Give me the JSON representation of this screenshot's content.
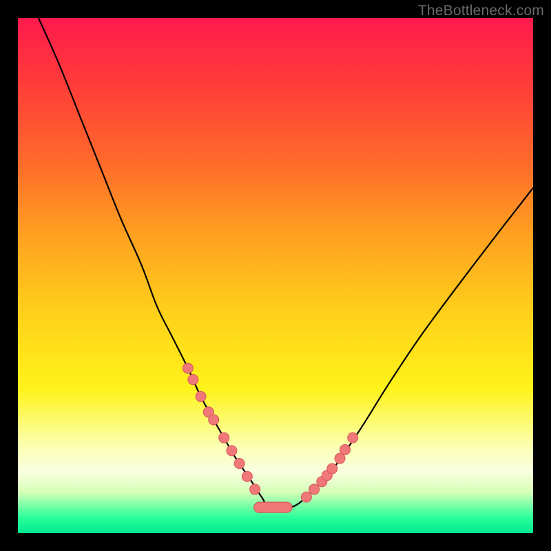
{
  "watermark": "TheBottleneck.com",
  "colors": {
    "gradient_top": "#ff1a4d",
    "gradient_bottom": "#00e890",
    "curve": "#000000",
    "dot_fill": "#f07878",
    "dot_stroke": "#d25858",
    "frame_bg": "#000000"
  },
  "chart_data": {
    "type": "line",
    "title": "",
    "xlabel": "",
    "ylabel": "",
    "xlim": [
      0,
      100
    ],
    "ylim": [
      0,
      100
    ],
    "note": "Plot area maps to 748x748 px inside a black 800x800 frame. y=0 at top, y=100 at bottom. Curve drawn from estimated points. Markers are salmon dots along the curve near the bottom; flat segment at the trough is a rounded pill.",
    "series": [
      {
        "name": "curve",
        "x": [
          4,
          8,
          12,
          16,
          20,
          24,
          27,
          30,
          33,
          35.5,
          38,
          40,
          42,
          44,
          45.7,
          47.3,
          49,
          53,
          56,
          58.5,
          60.8,
          63,
          67,
          72,
          78,
          85,
          93,
          100
        ],
        "y": [
          0,
          9,
          19,
          29,
          39,
          48,
          56,
          62,
          68,
          73.5,
          78,
          81.5,
          85,
          88,
          90.5,
          93,
          95,
          95,
          93,
          90.5,
          88,
          85,
          79,
          71,
          62,
          52.5,
          42,
          33
        ]
      }
    ],
    "markers": {
      "left_cluster": [
        [
          33.0,
          68.0
        ],
        [
          34.0,
          70.2
        ],
        [
          35.5,
          73.5
        ],
        [
          37.0,
          76.5
        ],
        [
          38.0,
          78.0
        ],
        [
          40.0,
          81.5
        ],
        [
          41.5,
          84.0
        ],
        [
          43.0,
          86.5
        ],
        [
          44.5,
          89.0
        ],
        [
          46.0,
          91.5
        ]
      ],
      "right_cluster": [
        [
          56.0,
          93.0
        ],
        [
          57.5,
          91.5
        ],
        [
          59.0,
          90.0
        ],
        [
          60.0,
          88.8
        ],
        [
          61.0,
          87.5
        ],
        [
          62.5,
          85.5
        ],
        [
          63.5,
          83.8
        ],
        [
          65.0,
          81.5
        ]
      ],
      "pill": {
        "x1": 45.8,
        "x2": 53.2,
        "y": 95.0
      }
    }
  }
}
